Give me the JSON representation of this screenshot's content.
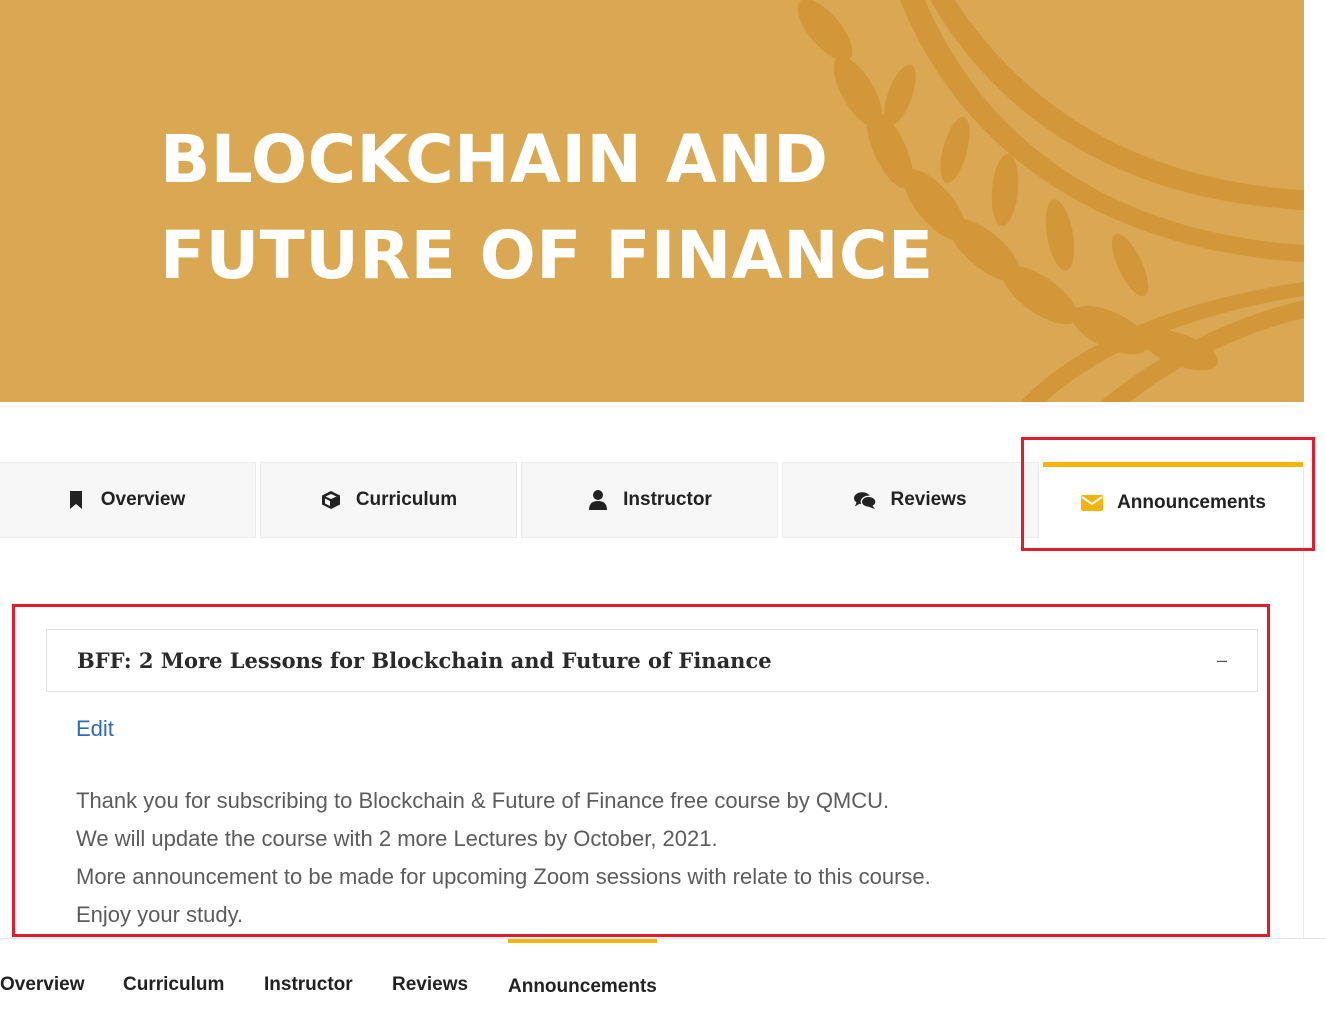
{
  "banner": {
    "title_line1": "BLOCKCHAIN AND",
    "title_line2": "FUTURE OF FINANCE",
    "background_color": "#daa853"
  },
  "tabs": [
    {
      "label": "Overview",
      "icon": "bookmark-icon"
    },
    {
      "label": "Curriculum",
      "icon": "cube-icon"
    },
    {
      "label": "Instructor",
      "icon": "user-icon"
    },
    {
      "label": "Reviews",
      "icon": "comments-icon"
    },
    {
      "label": "Announcements",
      "icon": "envelope-icon",
      "active": true
    }
  ],
  "announcement": {
    "title": "BFF: 2 More Lessons for Blockchain and Future of Finance",
    "toggle": "–",
    "edit_label": "Edit",
    "body": [
      "Thank you for subscribing to Blockchain & Future of Finance free course by QMCU.",
      "We will update the course with 2 more Lectures by October, 2021.",
      "More announcement to be made for upcoming Zoom sessions with relate to this course.",
      "Enjoy your study."
    ]
  },
  "bottom_nav": [
    "Overview",
    "Curriculum",
    "Instructor",
    "Reviews",
    "Announcements"
  ],
  "colors": {
    "accent": "#f6b30b",
    "highlight": "#e01e2b",
    "link": "#2c6cb3"
  }
}
